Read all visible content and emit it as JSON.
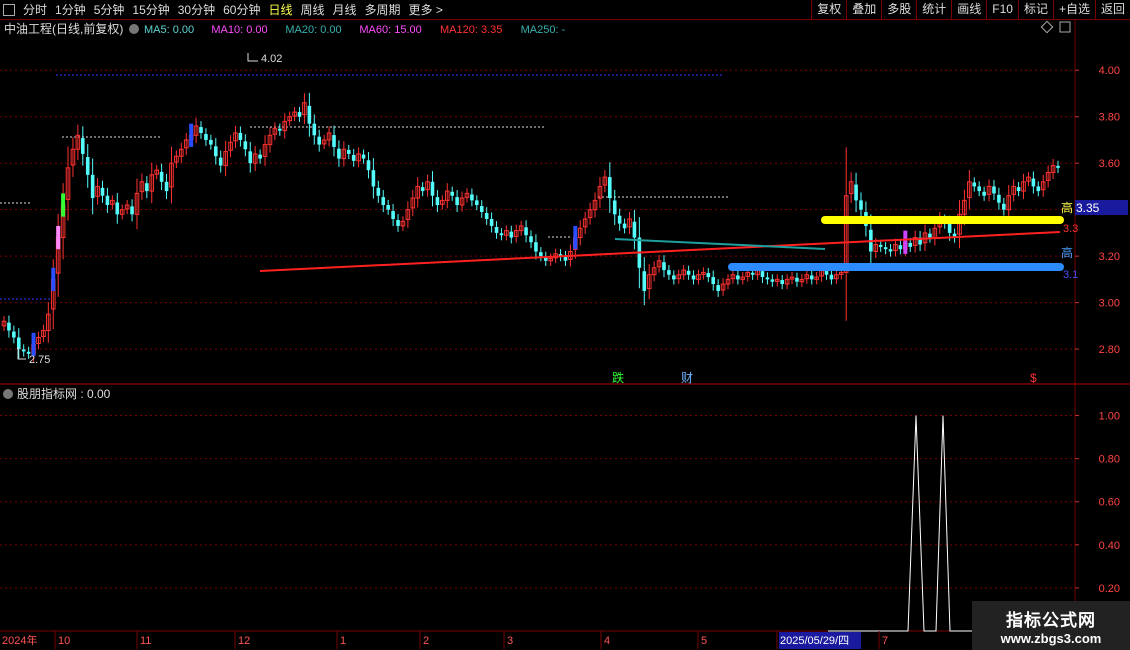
{
  "toolbar": {
    "periods": [
      "分时",
      "1分钟",
      "5分钟",
      "15分钟",
      "30分钟",
      "60分钟",
      "日线",
      "周线",
      "月线",
      "多周期",
      "更多 >"
    ],
    "active_period": "日线",
    "right_buttons": [
      "复权",
      "叠加",
      "多股",
      "统计",
      "画线",
      "F10",
      "标记",
      "+自选",
      "返回"
    ]
  },
  "main_panel": {
    "title": "中油工程(日线,前复权)",
    "ma_items": [
      {
        "label": "MA5: 0.00",
        "color": "#5fd3d3"
      },
      {
        "label": "MA10: 0.00",
        "color": "#ff4dff"
      },
      {
        "label": "MA20: 0.00",
        "color": "#3ab0b0"
      },
      {
        "label": "MA60: 15.00",
        "color": "#ff4dff"
      },
      {
        "label": "MA120: 3.35",
        "color": "#ff3333"
      },
      {
        "label": "MA250: -",
        "color": "#3ab0b0"
      }
    ],
    "high_label": "4.02",
    "low_label": "2.75",
    "markers": [
      {
        "text": "跌",
        "color": "#33ff33"
      },
      {
        "text": "财",
        "color": "#6fb3ff"
      },
      {
        "text": "$",
        "color": "#ff3333"
      }
    ],
    "right_tags": [
      {
        "text": "高",
        "color": "#ffff4d"
      },
      {
        "text": "3.35",
        "color": "#ffffff"
      },
      {
        "text": "3.3",
        "color": "#ff3333"
      },
      {
        "text": "高",
        "color": "#4d9fff"
      },
      {
        "text": "3.1",
        "color": "#4d4dff"
      }
    ]
  },
  "sub_panel": {
    "title": "股朋指标网",
    "value": "0.00"
  },
  "x_axis": {
    "labels": [
      "2024年",
      "10",
      "11",
      "12",
      "1",
      "2",
      "3",
      "4",
      "5",
      "2025/05/29/四",
      "7"
    ]
  },
  "watermark": {
    "title": "指标公式网",
    "url": "www.zbgs3.com"
  },
  "colors": {
    "up": "#ff3232",
    "down": "#54fcfc",
    "grid": "#7a0000",
    "ma120": "#ff2020",
    "ma250": "#1f9e9e",
    "yellow_band": "#ffff00",
    "blue_band": "#2c8cff"
  },
  "chart_data": [
    {
      "type": "candlestick",
      "title": "中油工程(日线,前复权)",
      "ylim": [
        2.68,
        4.1
      ],
      "yticks": [
        2.8,
        3.0,
        3.2,
        3.4,
        3.6,
        3.8,
        4.0
      ],
      "ytick_labels": [
        "2.80",
        "3.00",
        "3.20",
        "3.40",
        "3.60",
        "3.80",
        "4.00"
      ],
      "ohlc_close": [
        2.92,
        2.88,
        2.85,
        2.8,
        2.79,
        2.78,
        2.82,
        2.85,
        2.88,
        2.95,
        3.1,
        3.28,
        3.42,
        3.58,
        3.66,
        3.72,
        3.64,
        3.55,
        3.45,
        3.5,
        3.46,
        3.42,
        3.44,
        3.38,
        3.4,
        3.42,
        3.38,
        3.47,
        3.52,
        3.48,
        3.55,
        3.57,
        3.52,
        3.48,
        3.6,
        3.63,
        3.66,
        3.7,
        3.72,
        3.76,
        3.73,
        3.7,
        3.68,
        3.63,
        3.59,
        3.65,
        3.69,
        3.73,
        3.7,
        3.66,
        3.6,
        3.64,
        3.62,
        3.68,
        3.72,
        3.75,
        3.74,
        3.78,
        3.8,
        3.82,
        3.8,
        3.86,
        3.77,
        3.72,
        3.68,
        3.7,
        3.73,
        3.67,
        3.62,
        3.66,
        3.64,
        3.61,
        3.64,
        3.62,
        3.57,
        3.5,
        3.46,
        3.42,
        3.4,
        3.36,
        3.33,
        3.35,
        3.4,
        3.45,
        3.5,
        3.48,
        3.52,
        3.46,
        3.42,
        3.44,
        3.48,
        3.46,
        3.42,
        3.45,
        3.47,
        3.44,
        3.42,
        3.39,
        3.36,
        3.33,
        3.3,
        3.29,
        3.31,
        3.28,
        3.31,
        3.33,
        3.29,
        3.26,
        3.22,
        3.2,
        3.18,
        3.19,
        3.21,
        3.2,
        3.18,
        3.22,
        3.28,
        3.32,
        3.36,
        3.4,
        3.44,
        3.5,
        3.54,
        3.45,
        3.38,
        3.34,
        3.32,
        3.36,
        3.28,
        3.15,
        3.05,
        3.12,
        3.15,
        3.18,
        3.14,
        3.12,
        3.1,
        3.12,
        3.14,
        3.12,
        3.1,
        3.12,
        3.13,
        3.11,
        3.08,
        3.05,
        3.08,
        3.1,
        3.12,
        3.1,
        3.11,
        3.13,
        3.12,
        3.14,
        3.11,
        3.1,
        3.09,
        3.1,
        3.08,
        3.1,
        3.11,
        3.09,
        3.1,
        3.12,
        3.1,
        3.11,
        3.14,
        3.12,
        3.1,
        3.12,
        3.13,
        3.46,
        3.52,
        3.44,
        3.4,
        3.33,
        3.22,
        3.25,
        3.24,
        3.23,
        3.22,
        3.25,
        3.23,
        3.26,
        3.24,
        3.28,
        3.25,
        3.3,
        3.28,
        3.32,
        3.36,
        3.34,
        3.3,
        3.28,
        3.38,
        3.44,
        3.52,
        3.5,
        3.48,
        3.46,
        3.5,
        3.47,
        3.43,
        3.4,
        3.46,
        3.5,
        3.48,
        3.52,
        3.54,
        3.5,
        3.48,
        3.52,
        3.56,
        3.59,
        3.58
      ],
      "ma120": {
        "from": [
          260,
          252
        ],
        "to": [
          1060,
          213
        ]
      },
      "ma250": {
        "from": [
          615,
          220
        ],
        "to": [
          825,
          230
        ]
      },
      "high_point": 4.02,
      "low_point": 2.75
    },
    {
      "type": "line",
      "title": "股朋指标网",
      "ylim": [
        0,
        1.1
      ],
      "yticks": [
        0.2,
        0.4,
        0.6,
        0.8,
        1.0
      ],
      "ytick_labels": [
        "0.20",
        "0.40",
        "0.60",
        "0.80",
        "1.00"
      ],
      "values_sparse": [
        {
          "x_index": 185,
          "y": 0
        },
        {
          "x_index": 199,
          "y": 0
        },
        {
          "x_index": 200,
          "y": 1.0
        },
        {
          "x_index": 201,
          "y": 0
        },
        {
          "x_index": 206,
          "y": 0
        },
        {
          "x_index": 207,
          "y": 1.0
        },
        {
          "x_index": 208,
          "y": 0
        },
        {
          "x_index": 220,
          "y": 0
        }
      ]
    }
  ]
}
